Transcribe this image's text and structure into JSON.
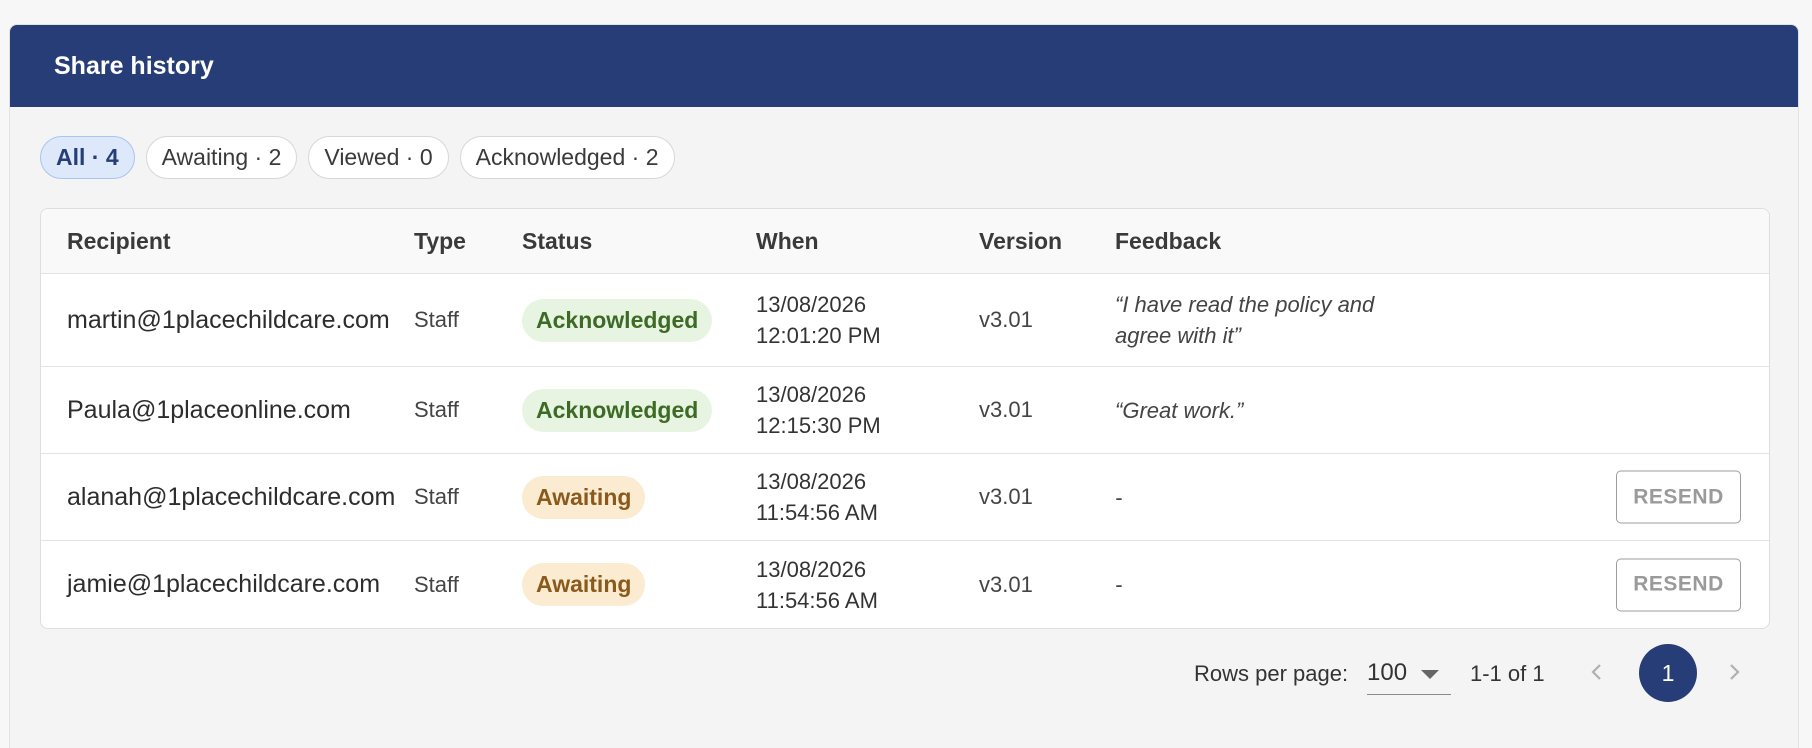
{
  "header": {
    "title": "Share history"
  },
  "filters": [
    {
      "label": "All · 4",
      "active": true
    },
    {
      "label": "Awaiting · 2",
      "active": false
    },
    {
      "label": "Viewed · 0",
      "active": false
    },
    {
      "label": "Acknowledged · 2",
      "active": false
    }
  ],
  "table": {
    "columns": [
      "Recipient",
      "Type",
      "Status",
      "When",
      "Version",
      "Feedback"
    ],
    "rows": [
      {
        "recipient": "martin@1placechildcare.com",
        "type": "Staff",
        "status": "Acknowledged",
        "date": "13/08/2026",
        "time": "12:01:20 PM",
        "version": "v3.01",
        "feedback": "“I have read the policy and agree with it”",
        "action": ""
      },
      {
        "recipient": "Paula@1placeonline.com",
        "type": "Staff",
        "status": "Acknowledged",
        "date": "13/08/2026",
        "time": "12:15:30 PM",
        "version": "v3.01",
        "feedback": "“Great work.”",
        "action": ""
      },
      {
        "recipient": "alanah@1placechildcare.com",
        "type": "Staff",
        "status": "Awaiting",
        "date": "13/08/2026",
        "time": "11:54:56 AM",
        "version": "v3.01",
        "feedback": "-",
        "action": "RESEND"
      },
      {
        "recipient": "jamie@1placechildcare.com",
        "type": "Staff",
        "status": "Awaiting",
        "date": "13/08/2026",
        "time": "11:54:56 AM",
        "version": "v3.01",
        "feedback": "-",
        "action": "RESEND"
      }
    ]
  },
  "pagination": {
    "rows_per_page_label": "Rows per page:",
    "rows_per_page": "100",
    "range": "1-1 of 1",
    "current_page": "1"
  },
  "colors": {
    "header_bg": "#273d77",
    "acknowledged_bg": "#e8f4e2",
    "acknowledged_text": "#3d6b25",
    "awaiting_bg": "#fbebd0",
    "awaiting_text": "#8a5a1c"
  }
}
